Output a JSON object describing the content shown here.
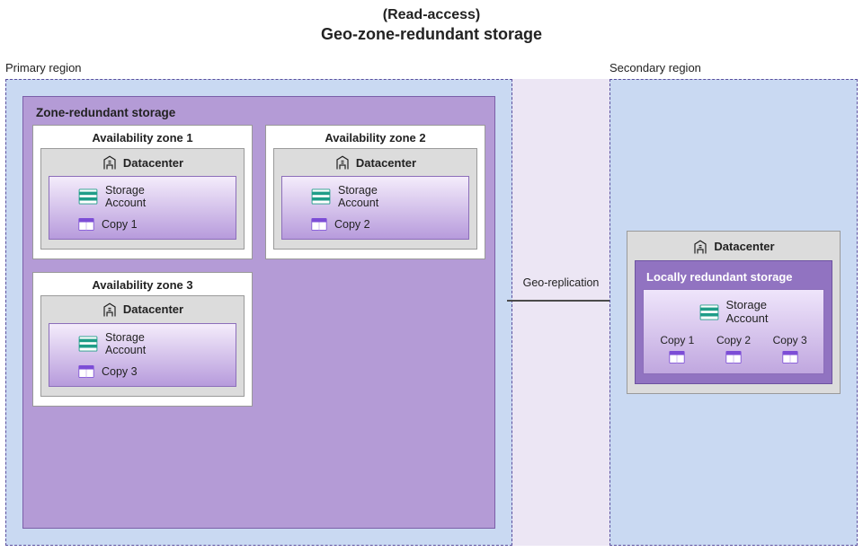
{
  "title_prefix": "(Read-access)",
  "title_main": "Geo-zone-redundant storage",
  "primary_region_label": "Primary region",
  "secondary_region_label": "Secondary region",
  "zrs_title": "Zone-redundant storage",
  "geo_replication_label": "Geo-replication",
  "datacenter_label": "Datacenter",
  "storage_account_label": "Storage\nAccount",
  "zones": [
    {
      "title": "Availability zone 1",
      "copy": "Copy 1"
    },
    {
      "title": "Availability zone 2",
      "copy": "Copy 2"
    },
    {
      "title": "Availability zone 3",
      "copy": "Copy 3"
    }
  ],
  "lrs_title": "Locally redundant storage",
  "lrs_copies": [
    "Copy 1",
    "Copy 2",
    "Copy 3"
  ]
}
